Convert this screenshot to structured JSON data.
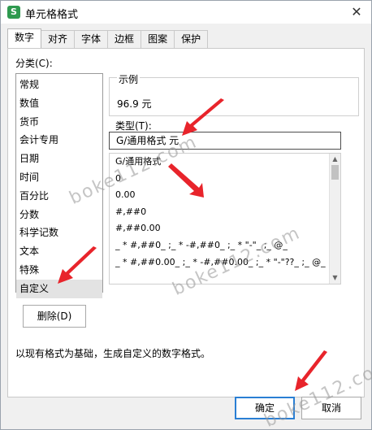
{
  "window": {
    "title": "单元格格式",
    "app_icon": "S"
  },
  "tabs": [
    "数字",
    "对齐",
    "字体",
    "边框",
    "图案",
    "保护"
  ],
  "category": {
    "label": "分类(C):",
    "items": [
      "常规",
      "数值",
      "货币",
      "会计专用",
      "日期",
      "时间",
      "百分比",
      "分数",
      "科学记数",
      "文本",
      "特殊",
      "自定义"
    ]
  },
  "delete_label": "删除(D)",
  "sample": {
    "label": "示例",
    "value": "96.9 元"
  },
  "type": {
    "label": "类型(T):",
    "value": "G/通用格式 元",
    "list": [
      "G/通用格式",
      "0",
      "0.00",
      "#,##0",
      "#,##0.00",
      "_ * #,##0_ ;_ * -#,##0_ ;_ * \"-\"_ ;_ @_",
      "_ * #,##0.00_ ;_ * -#,##0.00_ ;_ * \"-\"??_ ;_ @_"
    ]
  },
  "description": "以现有格式为基础，生成自定义的数字格式。",
  "buttons": {
    "ok": "确定",
    "cancel": "取消"
  },
  "watermarks": [
    "boke112.com",
    "boke112.com",
    "boke112.com"
  ],
  "colors": {
    "accent": "#2a7fd4",
    "arrow": "#e8242b",
    "app_icon": "#2e9a4f"
  }
}
